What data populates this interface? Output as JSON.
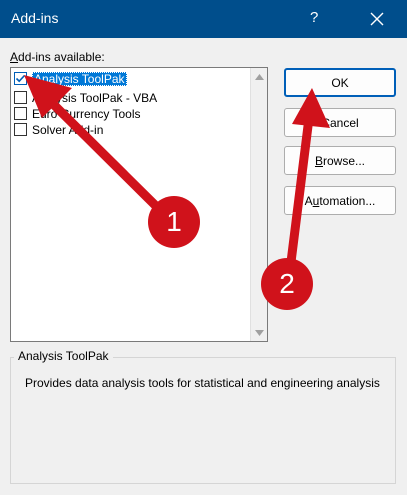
{
  "window": {
    "title": "Add-ins",
    "help_glyph": "?",
    "close_icon": "close-icon"
  },
  "list": {
    "label_access_key": "A",
    "label_rest": "dd-ins available:",
    "items": [
      {
        "label": "Analysis ToolPak",
        "checked": true,
        "selected": true
      },
      {
        "label": "Analysis ToolPak - VBA",
        "checked": false,
        "selected": false
      },
      {
        "label": "Euro Currency Tools",
        "checked": false,
        "selected": false
      },
      {
        "label": "Solver Add-in",
        "checked": false,
        "selected": false
      }
    ]
  },
  "buttons": {
    "ok": "OK",
    "cancel": "Cancel",
    "browse_key": "B",
    "browse_rest": "rowse...",
    "automation_key": "u",
    "automation_pre": "A",
    "automation_rest": "tomation..."
  },
  "details": {
    "title": "Analysis ToolPak",
    "description": "Provides data analysis tools for statistical and engineering analysis"
  },
  "annotations": {
    "badge1": "1",
    "badge2": "2",
    "color": "#d0121b"
  },
  "colors": {
    "titlebar": "#004e8c",
    "selection": "#0078d7",
    "default_button_border": "#005fb8"
  }
}
